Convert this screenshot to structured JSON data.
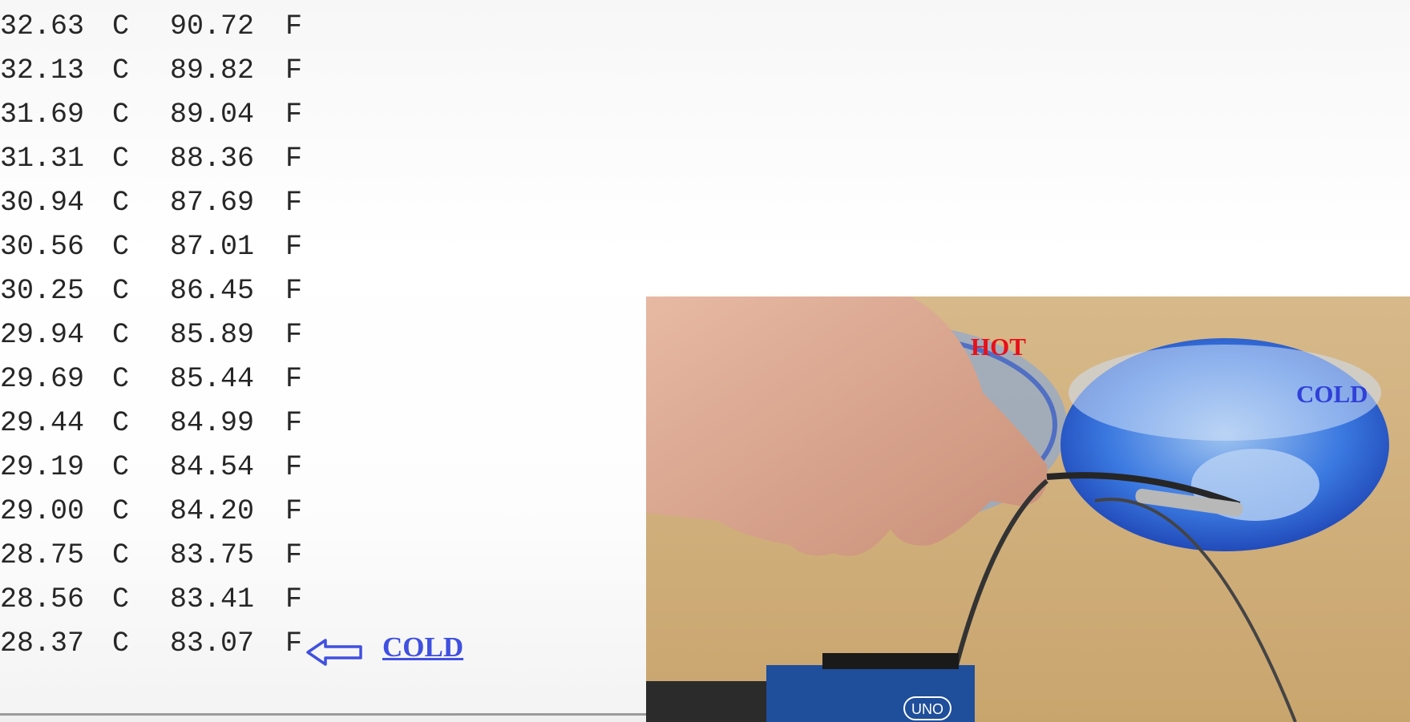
{
  "serial_monitor": {
    "rows": [
      {
        "celsius": "32.63",
        "c_unit": "C",
        "fahrenheit": "90.72",
        "f_unit": "F"
      },
      {
        "celsius": "32.13",
        "c_unit": "C",
        "fahrenheit": "89.82",
        "f_unit": "F"
      },
      {
        "celsius": "31.69",
        "c_unit": "C",
        "fahrenheit": "89.04",
        "f_unit": "F"
      },
      {
        "celsius": "31.31",
        "c_unit": "C",
        "fahrenheit": "88.36",
        "f_unit": "F"
      },
      {
        "celsius": "30.94",
        "c_unit": "C",
        "fahrenheit": "87.69",
        "f_unit": "F"
      },
      {
        "celsius": "30.56",
        "c_unit": "C",
        "fahrenheit": "87.01",
        "f_unit": "F"
      },
      {
        "celsius": "30.25",
        "c_unit": "C",
        "fahrenheit": "86.45",
        "f_unit": "F"
      },
      {
        "celsius": "29.94",
        "c_unit": "C",
        "fahrenheit": "85.89",
        "f_unit": "F"
      },
      {
        "celsius": "29.69",
        "c_unit": "C",
        "fahrenheit": "85.44",
        "f_unit": "F"
      },
      {
        "celsius": "29.44",
        "c_unit": "C",
        "fahrenheit": "84.99",
        "f_unit": "F"
      },
      {
        "celsius": "29.19",
        "c_unit": "C",
        "fahrenheit": "84.54",
        "f_unit": "F"
      },
      {
        "celsius": "29.00",
        "c_unit": "C",
        "fahrenheit": "84.20",
        "f_unit": "F"
      },
      {
        "celsius": "28.75",
        "c_unit": "C",
        "fahrenheit": "83.75",
        "f_unit": "F"
      },
      {
        "celsius": "28.56",
        "c_unit": "C",
        "fahrenheit": "83.41",
        "f_unit": "F"
      },
      {
        "celsius": "28.37",
        "c_unit": "C",
        "fahrenheit": "83.07",
        "f_unit": "F"
      }
    ]
  },
  "annotation": {
    "arrow_icon": "arrow-left-outline-icon",
    "cold_label": "COLD",
    "color": "#4050e0"
  },
  "photo": {
    "hot_label": "HOT",
    "hot_color": "#e8101a",
    "cold_label": "COLD",
    "cold_color": "#3040d8",
    "board_label": "UNO"
  }
}
